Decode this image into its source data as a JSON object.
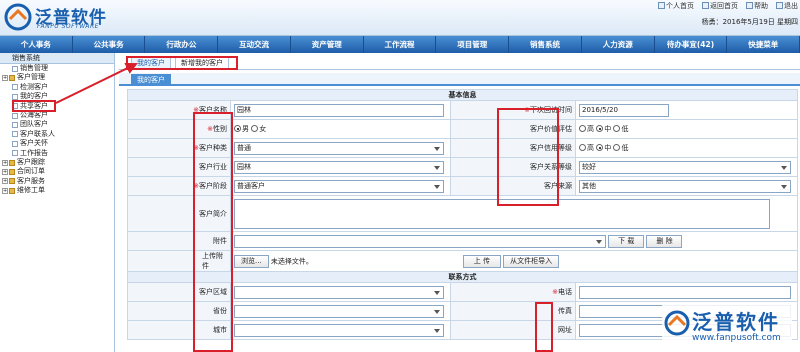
{
  "header": {
    "brand_cn": "泛普软件",
    "brand_en": "FANPU SOFTWARE",
    "links": [
      "个人首页",
      "返回首页",
      "帮助",
      "退出"
    ],
    "user_info": "杨勇：2016年5月19日 星期四"
  },
  "nav": [
    "个人事务",
    "公共事务",
    "行政办公",
    "互动交流",
    "资产管理",
    "工作流程",
    "项目管理",
    "销售系统",
    "人力资源",
    "待办事宜(42)",
    "快捷菜单"
  ],
  "sidebar": {
    "root": "销售系统",
    "items": [
      {
        "label": "销售管理",
        "lvl": 1
      },
      {
        "label": "客户管理",
        "lvl": 0
      },
      {
        "label": "检测客户",
        "lvl": 1
      },
      {
        "label": "我的客户",
        "lvl": 1
      },
      {
        "label": "共享客户",
        "lvl": 1
      },
      {
        "label": "公海客户",
        "lvl": 1
      },
      {
        "label": "团队客户",
        "lvl": 1
      },
      {
        "label": "客户联系人",
        "lvl": 1
      },
      {
        "label": "客户关怀",
        "lvl": 1
      },
      {
        "label": "工作报告",
        "lvl": 1
      },
      {
        "label": "客户跟踪",
        "lvl": 0
      },
      {
        "label": "合同订单",
        "lvl": 0
      },
      {
        "label": "客户服务",
        "lvl": 0
      },
      {
        "label": "维修工单",
        "lvl": 0
      }
    ]
  },
  "tabs": {
    "t1": "我的客户",
    "t2": "新增我的客户",
    "sub": "我的客户"
  },
  "form": {
    "sec_basic": "基本信息",
    "sec_contact": "联系方式",
    "name_label": "客户名称",
    "name_value": "园林",
    "next_visit_label": "下次回访时间",
    "next_visit_value": "2016/5/20",
    "gender_label": "性别",
    "gender_m": "男",
    "gender_f": "女",
    "value_label": "客户价值评估",
    "credit_label": "客户信用等级",
    "high": "高",
    "mid": "中",
    "low": "低",
    "type_label": "客户种类",
    "type_value": "普通",
    "industry_label": "客户行业",
    "industry_value": "园林",
    "relation_label": "客户关系等级",
    "relation_value": "较好",
    "stage_label": "客户阶段",
    "stage_value": "普通客户",
    "source_label": "客户来源",
    "source_value": "其他",
    "intro_label": "客户简介",
    "attach_label": "附件",
    "download": "下 载",
    "delete": "删 除",
    "upload_label": "上传附件",
    "browse": "浏览...",
    "no_file": "未选择文件。",
    "upload": "上 传",
    "import": "从文件柜导入",
    "region_label": "客户区域",
    "phone_label": "电话",
    "province_label": "省份",
    "fax_label": "传真",
    "city_label": "城市",
    "web_label": "网址"
  },
  "watermark": {
    "cn": "泛普软件",
    "url": "www.fanpusoft.com"
  },
  "colors": {
    "accent": "#1a5fae",
    "nav_bg": "#2f74c0",
    "highlight": "#d81f2a",
    "required": "#d81f2a"
  }
}
